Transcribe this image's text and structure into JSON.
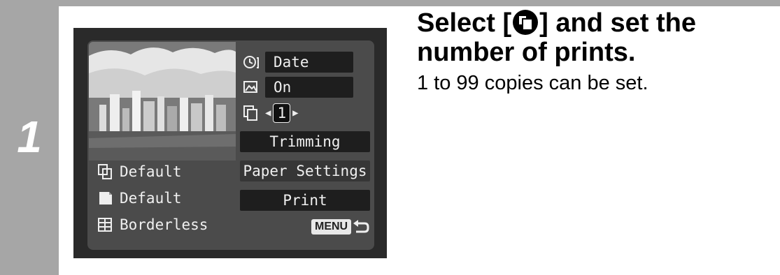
{
  "step": {
    "number": "1"
  },
  "camera_screen": {
    "date_label": "Date",
    "image_opt_label": "On",
    "copies_value": "1",
    "trimming_label": "Trimming",
    "paper_settings_label": "Paper Settings",
    "print_label": "Print",
    "menu_label": "MENU",
    "paper_size": "Default",
    "paper_type": "Default",
    "layout": "Borderless"
  },
  "instructions": {
    "heading_line1_pre": "Select [",
    "heading_line1_post": "] and set the",
    "heading_line2": "number of prints.",
    "detail": "1 to 99 copies can be set."
  },
  "icons": [
    "clock-icon",
    "image-optimize-icon",
    "copies-icon",
    "paper-size-icon",
    "paper-type-icon",
    "layout-icon",
    "return-icon"
  ]
}
